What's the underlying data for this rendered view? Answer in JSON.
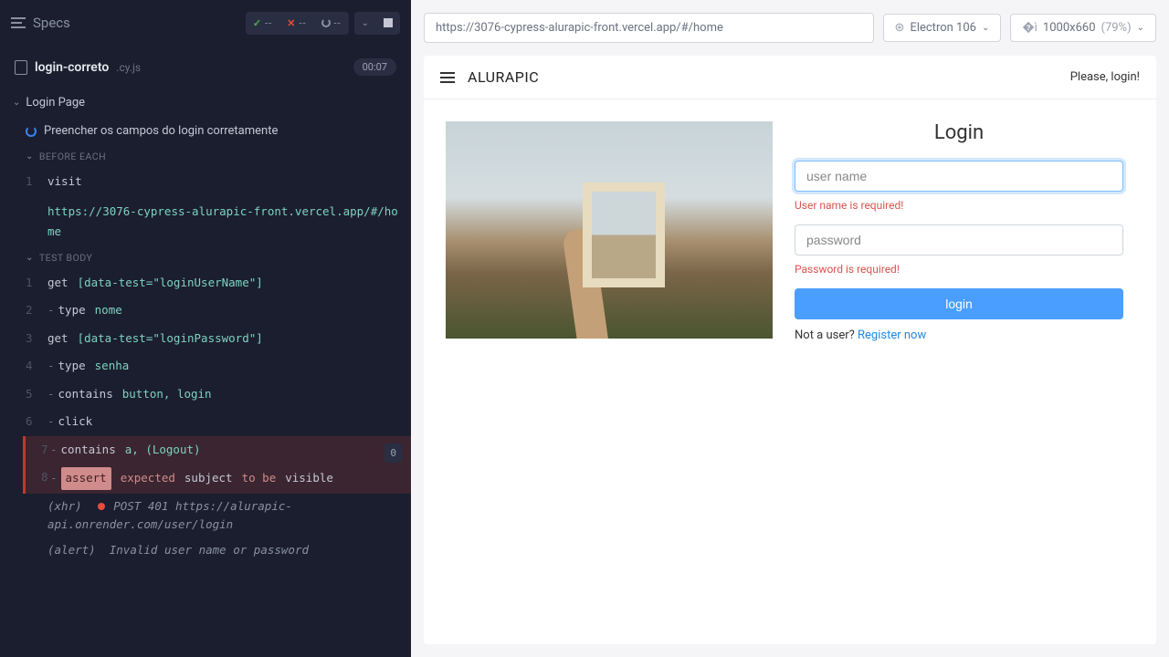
{
  "header": {
    "specs_label": "Specs",
    "pass_dash": "--",
    "fail_dash": "--",
    "pending_dash": "--"
  },
  "spec": {
    "name": "login-correto",
    "ext": ".cy.js",
    "elapsed": "00:07"
  },
  "describe": {
    "title": "Login Page"
  },
  "test": {
    "title": "Preencher os campos do login corretamente"
  },
  "sections": {
    "before_each": "BEFORE EACH",
    "test_body": "TEST BODY"
  },
  "before": {
    "r1": {
      "num": "1",
      "cmd": "visit",
      "arg": "https://3076-cypress-alurapic-front.vercel.app/#/home"
    }
  },
  "body": {
    "r1": {
      "num": "1",
      "cmd": "get",
      "arg": "[data-test=\"loginUserName\"]"
    },
    "r2": {
      "num": "2",
      "cmd": "type",
      "arg": "nome"
    },
    "r3": {
      "num": "3",
      "cmd": "get",
      "arg": "[data-test=\"loginPassword\"]"
    },
    "r4": {
      "num": "4",
      "cmd": "type",
      "arg": "senha"
    },
    "r5": {
      "num": "5",
      "cmd": "contains",
      "arg": "button, login"
    },
    "r6": {
      "num": "6",
      "cmd": "click",
      "arg": ""
    },
    "r7": {
      "num": "7",
      "cmd": "contains",
      "arg": "a, (Logout)",
      "badge": "0"
    },
    "r8": {
      "num": "8",
      "cmd": "assert",
      "expected": "expected",
      "subject": "subject",
      "rest": "to be",
      "vis": "visible"
    }
  },
  "logs": {
    "xhr": {
      "tag": "(xhr)",
      "text": "POST 401 https://alurapic-api.onrender.com/user/login"
    },
    "alert": {
      "tag": "(alert)",
      "text": "Invalid user name or password"
    }
  },
  "aut": {
    "url": "https://3076-cypress-alurapic-front.vercel.app/#/home",
    "browser": "Electron 106",
    "viewport": "1000x660",
    "zoom": "(79%)"
  },
  "app": {
    "brand": "ALURAPIC",
    "please_login": "Please, login!",
    "login_title": "Login",
    "user_placeholder": "user name",
    "user_error": "User name is required!",
    "pass_placeholder": "password",
    "pass_error": "Password is required!",
    "login_button": "login",
    "not_user": "Not a user? ",
    "register": "Register now"
  }
}
